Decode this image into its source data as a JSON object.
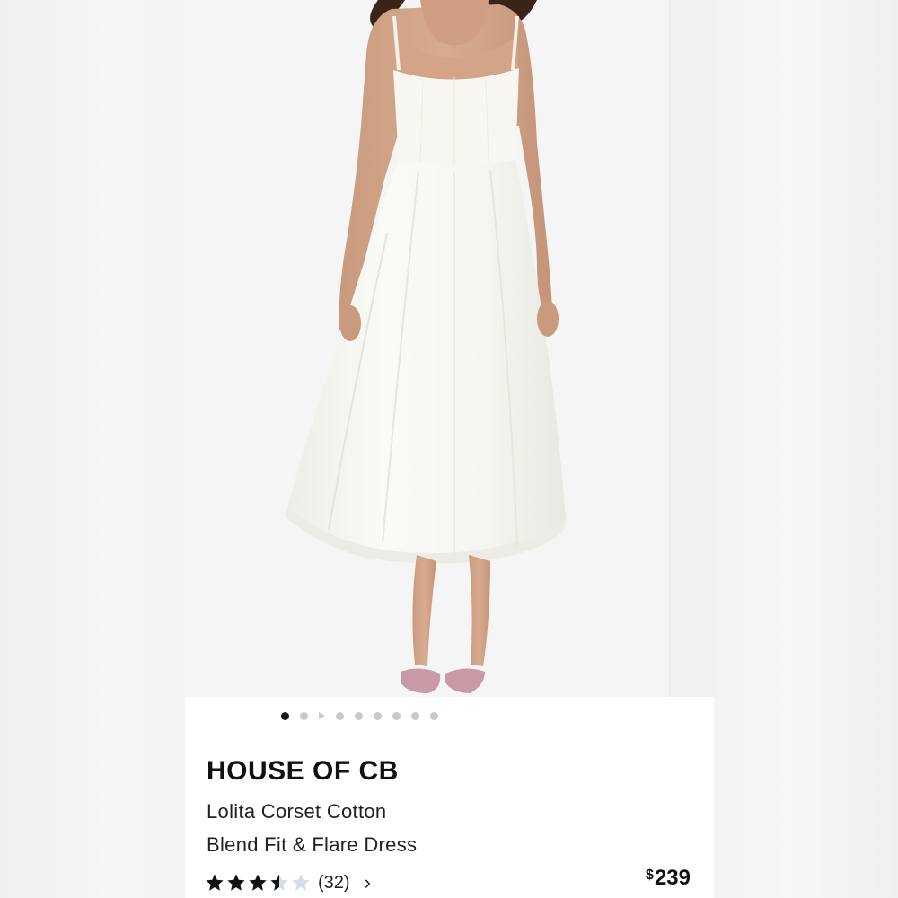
{
  "product": {
    "brand": "HOUSE OF CB",
    "title_line1": "Lolita Corset Cotton",
    "title_line2": "Blend Fit & Flare Dress",
    "rating": 3.5,
    "rating_max": 5,
    "review_count": "(32)",
    "price_currency": "$",
    "price_value": "239"
  },
  "carousel": {
    "total": 9,
    "active_index": 0,
    "video_index": 2
  },
  "colors": {
    "star_filled": "#111111",
    "star_empty": "#d6dde3",
    "dot_active": "#1b1b1b",
    "dot_inactive": "#c9c9c9",
    "dress": "#f7f6f1",
    "shoe": "#c99aa6"
  },
  "icons": {
    "chevron": "›",
    "video": "play-icon"
  }
}
